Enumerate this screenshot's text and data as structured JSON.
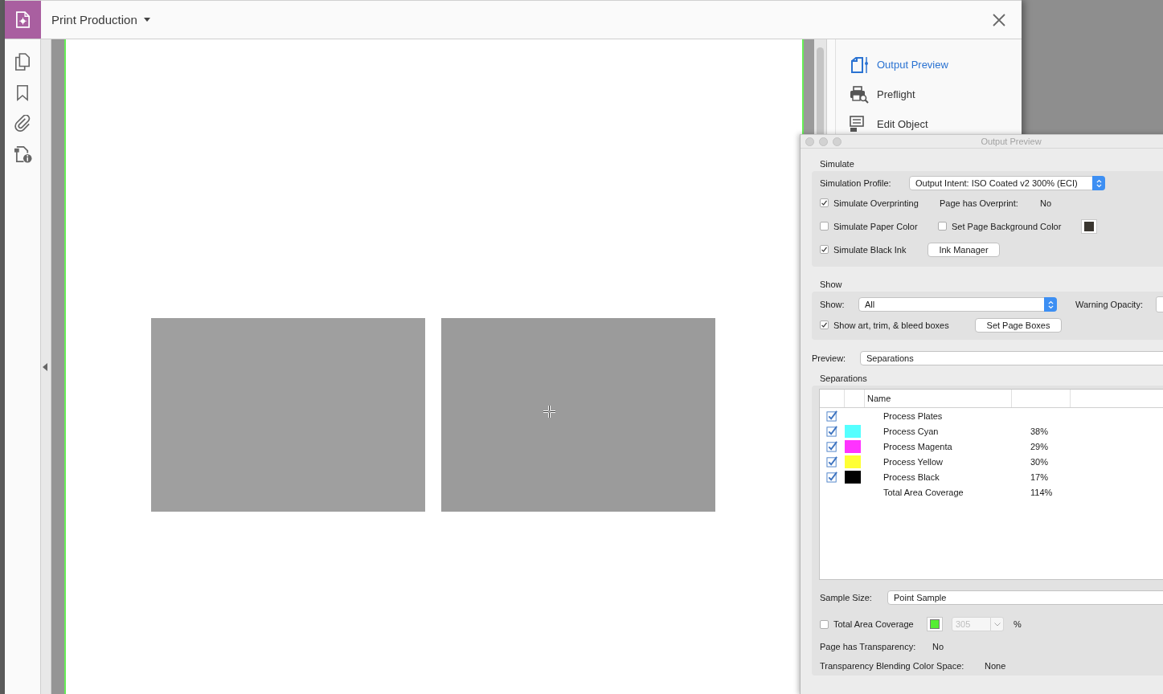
{
  "app": {
    "title": "Print Production"
  },
  "tools": [
    {
      "label": "Output Preview",
      "selected": true
    },
    {
      "label": "Preflight",
      "selected": false
    },
    {
      "label": "Edit Object",
      "selected": false
    }
  ],
  "output_preview": {
    "title": "Output Preview",
    "simulate": {
      "heading": "Simulate",
      "profile_label": "Simulation Profile:",
      "profile": "Output Intent: ISO Coated v2 300% (ECI)",
      "overprinting": {
        "label": "Simulate Overprinting",
        "checked": true
      },
      "overprint_label": "Page has Overprint:",
      "overprint_value": "No",
      "paper_color": {
        "label": "Simulate Paper Color",
        "checked": false
      },
      "page_background": {
        "label": "Set Page Background Color",
        "checked": false
      },
      "black_ink": {
        "label": "Simulate Black Ink",
        "checked": true
      },
      "ink_manager": "Ink Manager"
    },
    "show": {
      "heading": "Show",
      "show_label": "Show:",
      "show_value": "All",
      "warning_label": "Warning Opacity:",
      "boxes": {
        "label": "Show art, trim, & bleed boxes",
        "checked": true
      },
      "set_page_boxes": "Set Page Boxes"
    },
    "preview_label": "Preview:",
    "preview_value": "Separations",
    "separations": {
      "heading": "Separations",
      "columns": [
        "Name"
      ],
      "rows": [
        {
          "kind": "plates",
          "checked": true,
          "name": "Process Plates"
        },
        {
          "kind": "ink",
          "checked": true,
          "color": "#55ffff",
          "name": "Process Cyan",
          "coverage": "38%"
        },
        {
          "kind": "ink",
          "checked": true,
          "color": "#ff33ff",
          "name": "Process Magenta",
          "coverage": "29%"
        },
        {
          "kind": "ink",
          "checked": true,
          "color": "#ffff33",
          "name": "Process Yellow",
          "coverage": "30%"
        },
        {
          "kind": "ink",
          "checked": true,
          "color": "#000000",
          "name": "Process Black",
          "coverage": "17%"
        }
      ],
      "total": {
        "name": "Total Area Coverage",
        "coverage": "114%"
      }
    },
    "sample_label": "Sample Size:",
    "sample_value": "Point Sample",
    "tac": {
      "label": "Total Area Coverage",
      "checked": false,
      "value": "305",
      "disabled": true,
      "unit": "%"
    },
    "transparency_label": "Page has Transparency:",
    "transparency_value": "No",
    "blending_label": "Transparency Blending Color Space:",
    "blending_value": "None"
  }
}
